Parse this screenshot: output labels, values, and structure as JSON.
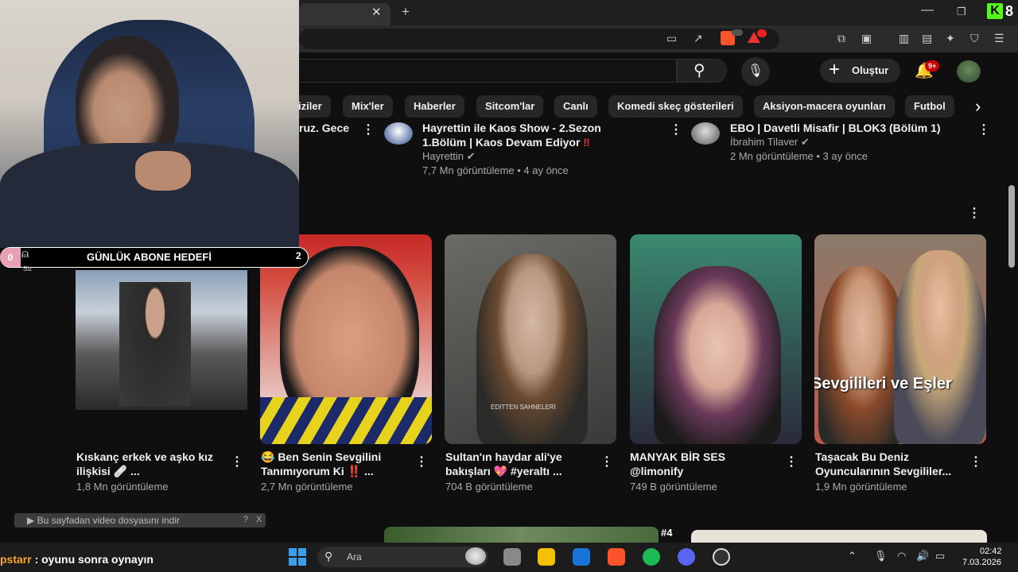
{
  "browser": {
    "tab_close": "✕",
    "new_tab": "+",
    "kick_logo": "K",
    "kick_count": "8"
  },
  "youtube": {
    "create_label": "Oluştur",
    "notif_badge": "9+",
    "chips": [
      "iziler",
      "Mix'ler",
      "Haberler",
      "Sitcom'lar",
      "Canlı",
      "Komedi skeç gösterileri",
      "Aksiyon-macera oyunları",
      "Futbol"
    ],
    "top_results": [
      {
        "title_frag": "ruz. Gece"
      },
      {
        "title_line1": "Hayrettin ile Kaos Show - 2.Sezon",
        "title_line2": "1.Bölüm | Kaos Devam Ediyor",
        "title_mark": "‼",
        "channel": "Hayrettin",
        "meta": "7,7 Mn görüntüleme • 4 ay önce"
      },
      {
        "title_line1": "EBO | Davetli Misafir | BLOK3 (Bölüm 1)",
        "channel": "İbrahim Tilaver",
        "meta": "2 Mn görüntüleme • 3 ay önce"
      }
    ],
    "shorts": [
      {
        "title": "Kıskanç erkek ve aşko kız ilişkisi 🩹 ...",
        "views": "1,8 Mn görüntüleme"
      },
      {
        "title": "😂 Ben Senin Sevgilini Tanımıyorum Ki ‼️ ...",
        "views": "2,7 Mn görüntüleme"
      },
      {
        "title": "Sultan'ın haydar ali'ye bakışları 💖 #yeraltı ...",
        "views": "704 B görüntüleme",
        "overlay": "EDITTEN SAHNELERİ"
      },
      {
        "title": "MANYAK BİR SES @limonify",
        "views": "749 B görüntüleme"
      },
      {
        "title": "Taşacak Bu Deniz Oyuncularının Sevgililer...",
        "views": "1,9 Mn görüntüleme",
        "overlay": "Sevgilileri ve Eşler"
      }
    ],
    "next_rank": "#4"
  },
  "overlay": {
    "goal_left": "0",
    "goal_label": "GÜNLÜK ABONE HEDEFİ",
    "goal_right": "2",
    "goal_user_caption": "Siz",
    "download_text": "▶ Bu sayfadan video dosyasını indir",
    "download_q": "?",
    "download_x": "X"
  },
  "chat": {
    "user": "pstarr",
    "message": " : oyunu sonra oynayın"
  },
  "taskbar": {
    "search_label": "Ara",
    "time": "02:42",
    "date": "7.03.2026"
  }
}
